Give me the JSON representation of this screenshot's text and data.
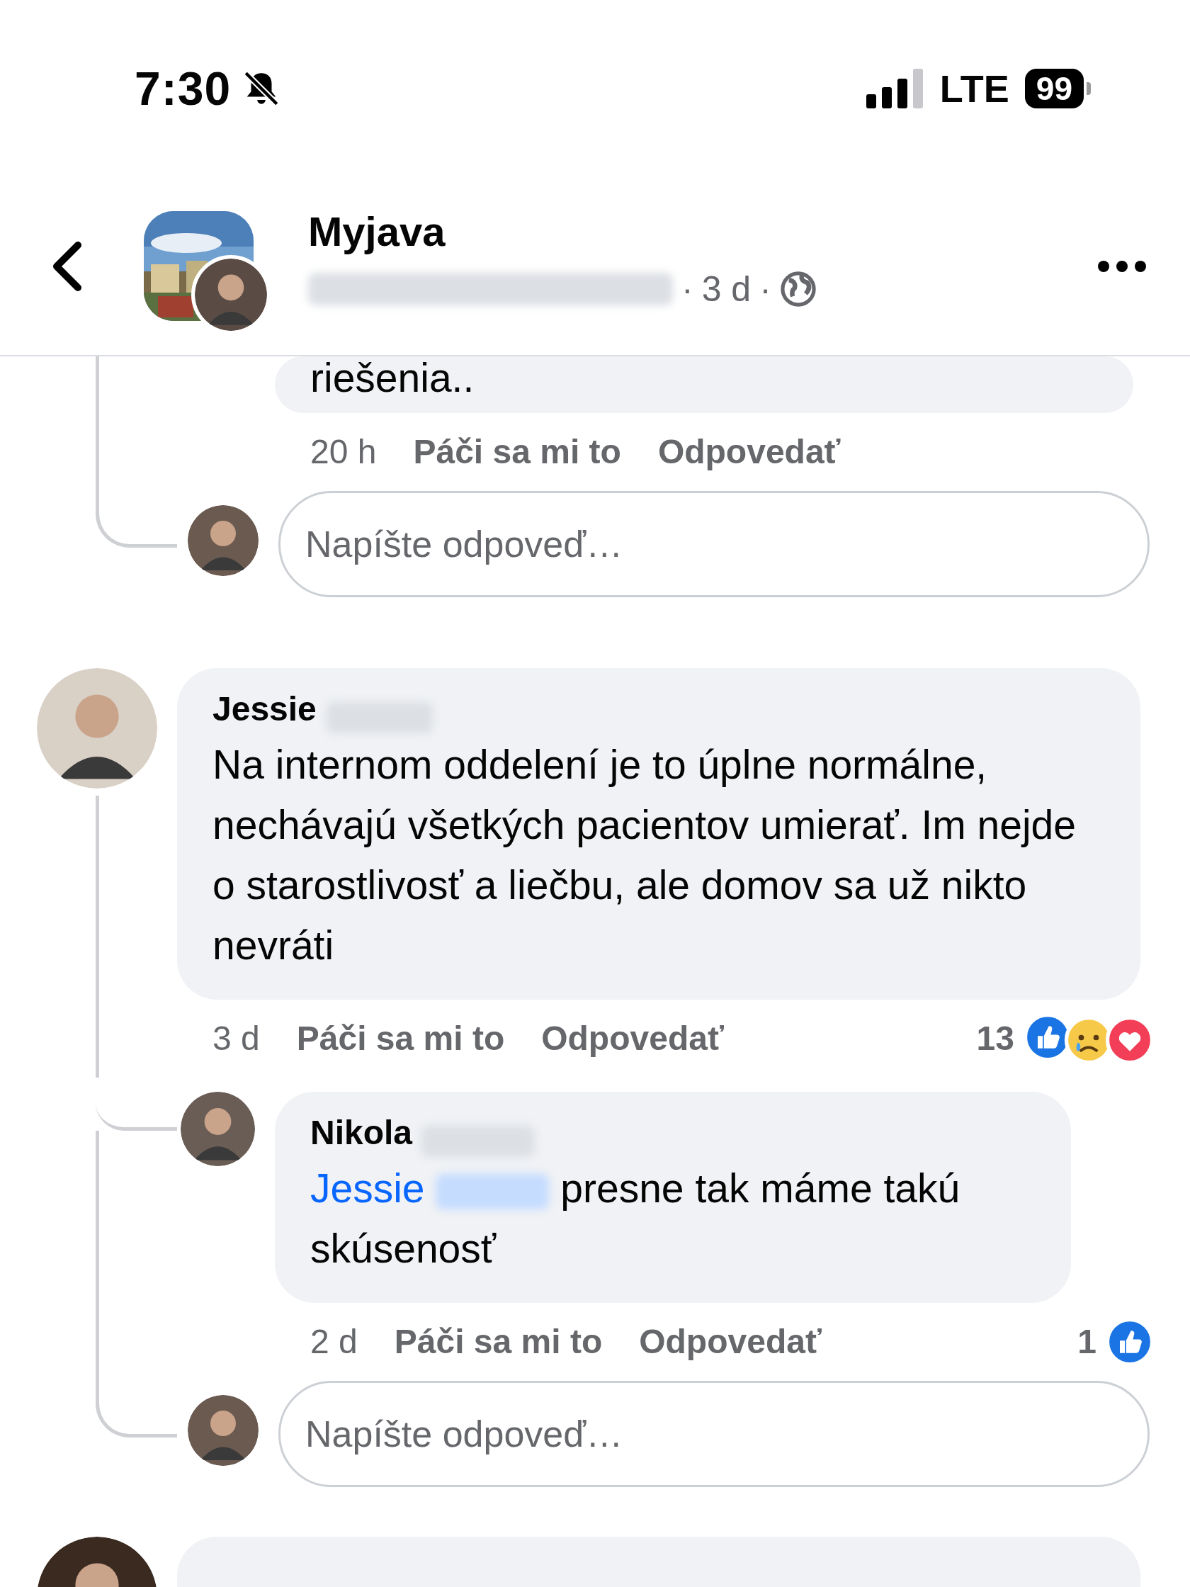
{
  "status_bar": {
    "time": "7:30",
    "network": "LTE",
    "battery": "99"
  },
  "header": {
    "title": "Myjava",
    "dot_1": "·",
    "age": "3 d",
    "dot_2": "·"
  },
  "top_reply": {
    "text": "riešenia..",
    "time": "20 h",
    "like": "Páči sa mi to",
    "reply": "Odpovedať"
  },
  "reply_box_1": {
    "placeholder": "Napíšte odpoveď…"
  },
  "comment": {
    "author": "Jessie",
    "text": "Na internom oddelení je to úplne normálne, nechávajú všetkých pacientov umierať. Im nejde o starostlivosť a liečbu, ale domov sa už nikto nevráti",
    "time": "3 d",
    "like": "Páči sa mi to",
    "reply": "Odpovedať",
    "reaction_count": "13"
  },
  "replies": [
    {
      "author": "Nikola",
      "mention": "Jessie",
      "text": "presne tak máme takú skúsenosť",
      "time": "2 d",
      "like": "Páči sa mi to",
      "reply": "Odpovedať",
      "reaction_count": "1"
    }
  ],
  "reply_box_2": {
    "placeholder": "Napíšte odpoveď…"
  }
}
